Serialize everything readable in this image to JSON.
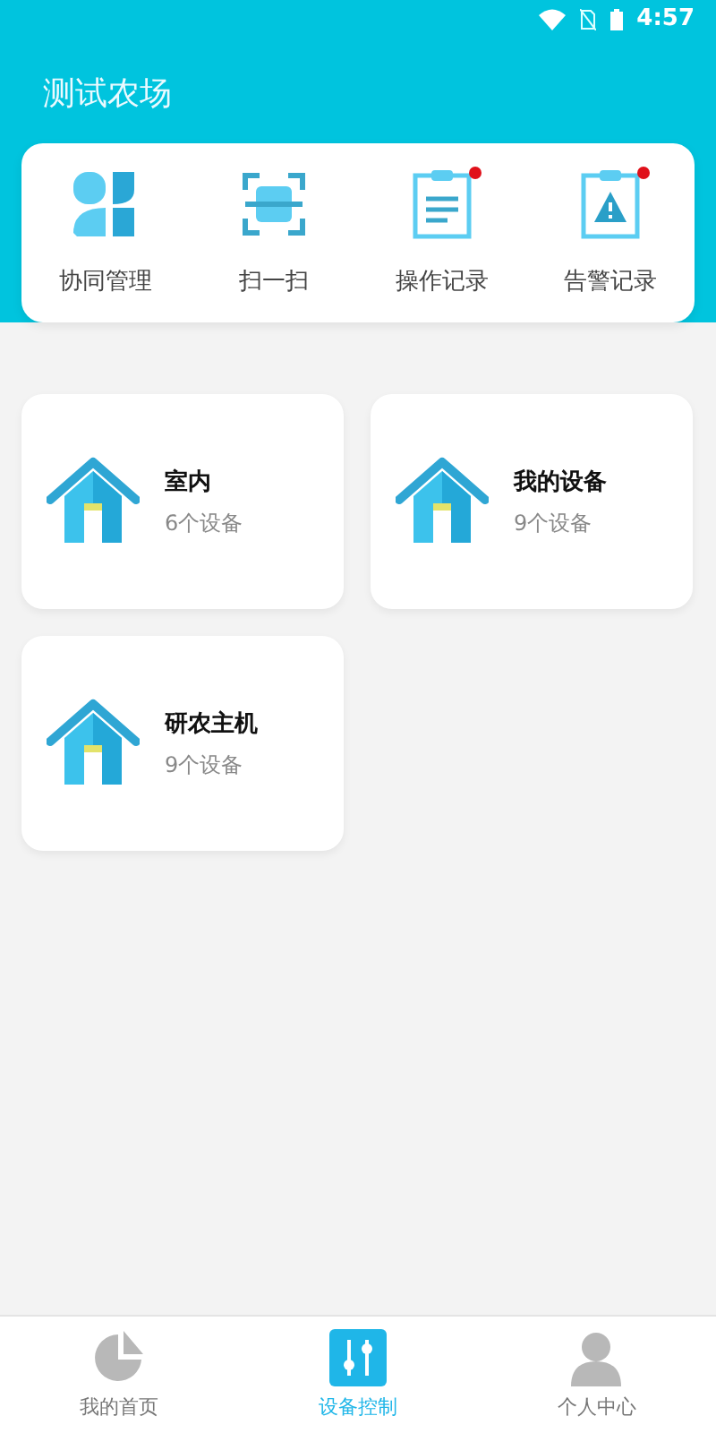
{
  "status_bar": {
    "time": "4:57"
  },
  "header": {
    "title": "测试农场"
  },
  "quick_actions": [
    {
      "kind": "team",
      "label": "协同管理",
      "badge": false
    },
    {
      "kind": "scan",
      "label": "扫一扫",
      "badge": false
    },
    {
      "kind": "log",
      "label": "操作记录",
      "badge": true
    },
    {
      "kind": "alert",
      "label": "告警记录",
      "badge": true
    }
  ],
  "devices": [
    {
      "name": "室内",
      "count": "6个设备"
    },
    {
      "name": "我的设备",
      "count": "9个设备"
    },
    {
      "name": "研农主机",
      "count": "9个设备"
    }
  ],
  "bottom_nav": [
    {
      "kind": "home",
      "label": "我的首页",
      "selected": false
    },
    {
      "kind": "control",
      "label": "设备控制",
      "selected": true
    },
    {
      "kind": "profile",
      "label": "个人中心",
      "selected": false
    }
  ]
}
